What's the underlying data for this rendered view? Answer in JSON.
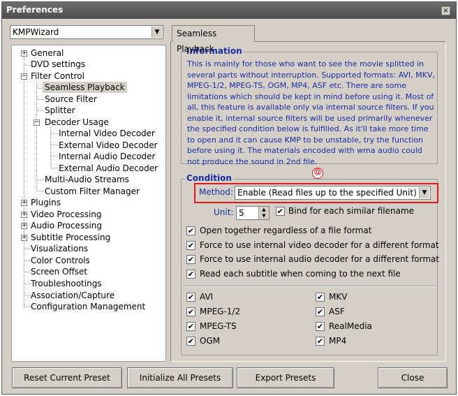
{
  "window": {
    "title": "Preferences",
    "close_glyph": "×"
  },
  "preset": {
    "selected": "KMPWizard"
  },
  "tree": {
    "items": [
      {
        "label": "General",
        "expander": "+"
      },
      {
        "label": "DVD settings"
      },
      {
        "label": "Filter Control",
        "expander": "−"
      },
      {
        "label": "Seamless Playback",
        "selected": true
      },
      {
        "label": "Source Filter"
      },
      {
        "label": "Splitter"
      },
      {
        "label": "Decoder Usage",
        "expander": "−"
      },
      {
        "label": "Internal Video Decoder"
      },
      {
        "label": "External Video Decoder"
      },
      {
        "label": "Internal Audio Decoder"
      },
      {
        "label": "External Audio Decoder"
      },
      {
        "label": "Multi-Audio Streams"
      },
      {
        "label": "Custom Filter Manager"
      },
      {
        "label": "Plugins",
        "expander": "+"
      },
      {
        "label": "Video Processing",
        "expander": "+"
      },
      {
        "label": "Audio Processing",
        "expander": "+"
      },
      {
        "label": "Subtitle Processing",
        "expander": "+"
      },
      {
        "label": "Visualizations"
      },
      {
        "label": "Color Controls"
      },
      {
        "label": "Screen Offset"
      },
      {
        "label": "Troubleshootings"
      },
      {
        "label": "Association/Capture"
      },
      {
        "label": "Configuration Management"
      }
    ]
  },
  "tab": {
    "label": "Seamless Playback"
  },
  "info": {
    "title": "Information",
    "text": "This is mainly for those who want to see the movie splitted in several parts without interruption. Supported formats: AVI, MKV, MPEG-1/2, MPEG-TS, OGM, MP4, ASF etc. There are some limitations which should be kept in mind before using it. Most of all, this feature is available only via internal source filters. If you enable it, internal source filters will be used primarily whenever the specified condition below is fulfilled. As it'll take more time to open and it can cause KMP to be unstable, try the function before using it. The materials encoded with wma audio could not produce the sound in 2nd file."
  },
  "condition": {
    "title": "Condition",
    "badge": "⑫",
    "method_label": "Method:",
    "method_value": "Enable (Read files up to the specified Unit)",
    "unit_label": "Unit:",
    "unit_value": "5",
    "bind_label": "Bind for each similar filename",
    "options": [
      "Open together regardless of a file format",
      "Force to use internal video decoder for a different format",
      "Force to use internal audio decoder for a different format",
      "Read each subtitle when coming to the next file"
    ],
    "formats_left": [
      "AVI",
      "MPEG-1/2",
      "MPEG-TS",
      "OGM"
    ],
    "formats_right": [
      "MKV",
      "ASF",
      "RealMedia",
      "MP4"
    ],
    "check_glyph": "✔"
  },
  "buttons": {
    "reset": "Reset Current Preset",
    "initialize": "Initialize All Presets",
    "export": "Export Presets",
    "close": "Close"
  },
  "colors": {
    "accent_text": "#1c2aa5",
    "highlight": "#e01818",
    "face": "#d4d0c8"
  }
}
